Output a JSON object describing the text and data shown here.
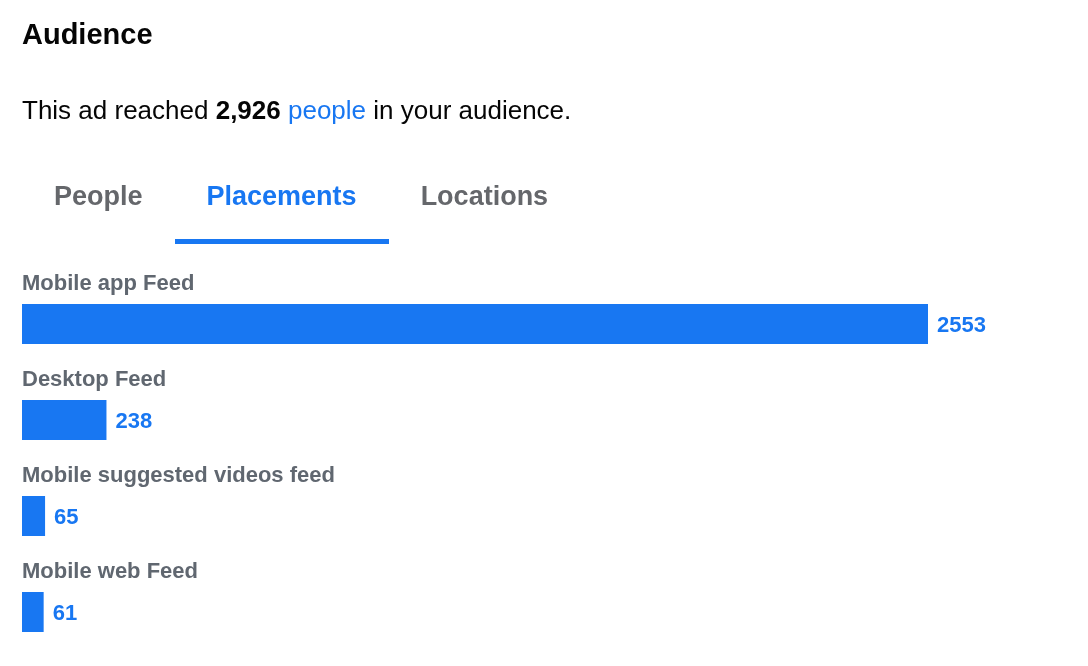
{
  "title": "Audience",
  "summary_parts": {
    "before": "This ad reached ",
    "count": "2,926",
    "link": "people",
    "after": " in your audience."
  },
  "tabs": [
    {
      "label": "People",
      "selected": false
    },
    {
      "label": "Placements",
      "selected": true
    },
    {
      "label": "Locations",
      "selected": false
    }
  ],
  "placements_chart": {
    "chart_data": {
      "type": "bar",
      "orientation": "horizontal",
      "data_labels": true,
      "categories": [
        "Mobile app Feed",
        "Desktop Feed",
        "Mobile suggested videos feed",
        "Mobile web Feed"
      ],
      "series": [
        {
          "color": "#1877f2",
          "values": [
            2553,
            238,
            65,
            61
          ]
        }
      ]
    }
  }
}
